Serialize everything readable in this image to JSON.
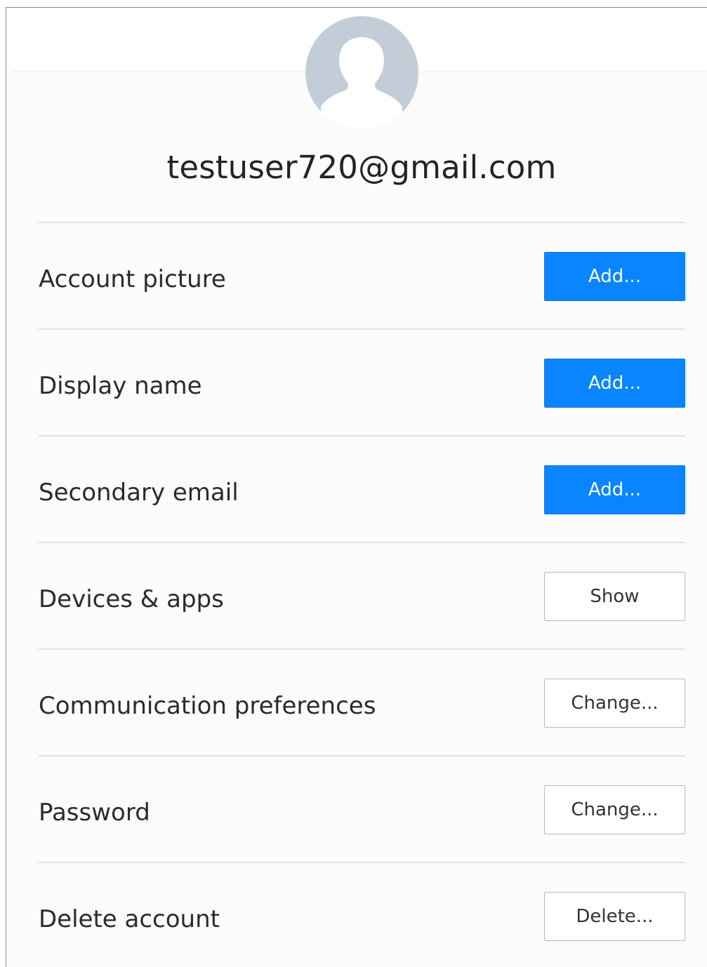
{
  "account": {
    "email": "testuser720@gmail.com"
  },
  "colors": {
    "primary_button": "#0a84ff",
    "avatar_bg": "#c3cdd7"
  },
  "rows": [
    {
      "label": "Account picture",
      "button": "Add...",
      "style": "primary"
    },
    {
      "label": "Display name",
      "button": "Add...",
      "style": "primary"
    },
    {
      "label": "Secondary email",
      "button": "Add...",
      "style": "primary"
    },
    {
      "label": "Devices & apps",
      "button": "Show",
      "style": "secondary"
    },
    {
      "label": "Communication preferences",
      "button": "Change...",
      "style": "secondary"
    },
    {
      "label": "Password",
      "button": "Change...",
      "style": "secondary"
    },
    {
      "label": "Delete account",
      "button": "Delete...",
      "style": "secondary"
    }
  ]
}
